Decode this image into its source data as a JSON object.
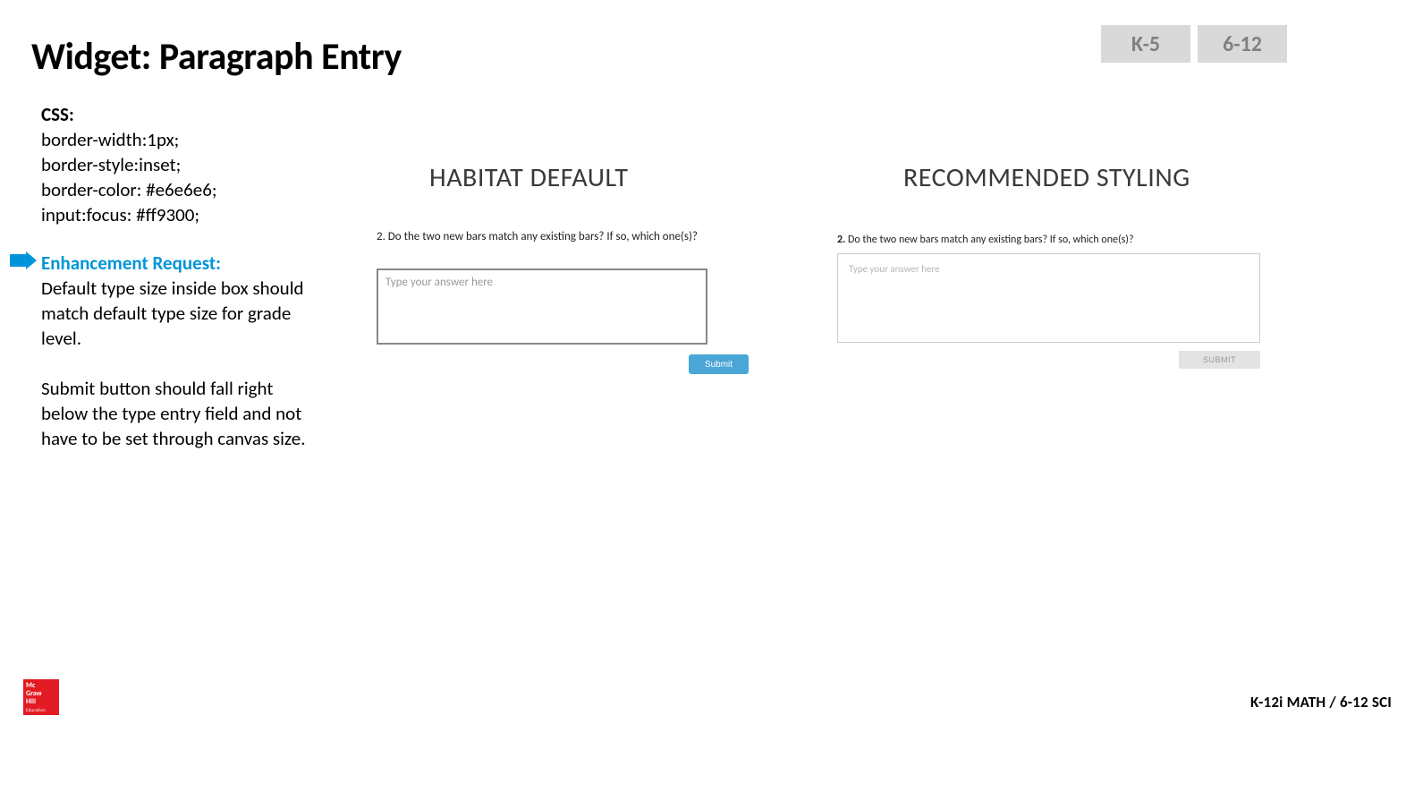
{
  "title": "Widget: Paragraph Entry",
  "tabs": {
    "k5": "K-5",
    "g612": "6-12"
  },
  "css": {
    "label": "CSS:",
    "lines": [
      "border-width:1px;",
      "border-style:inset;",
      "border-color: #e6e6e6;",
      "input:focus: #ff9300;"
    ]
  },
  "enhancement": {
    "title": "Enhancement Request:",
    "p1": "Default type size inside box should match default type size for grade level.",
    "p2": "Submit button should fall right below the type entry field and not have to be set through canvas size."
  },
  "columns": {
    "left_heading": "HABITAT DEFAULT",
    "right_heading": "RECOMMENDED STYLING"
  },
  "default_example": {
    "question": "2. Do the two new bars match any existing bars? If so, which one(s)?",
    "placeholder": "Type your answer here",
    "submit": "Submit"
  },
  "reco_example": {
    "qnum": "2.",
    "question": " Do the two new bars match any existing bars? If so, which one(s)?",
    "placeholder": "Type your answer here",
    "submit": "SUBMIT"
  },
  "logo": {
    "l1": "Mc",
    "l2": "Graw",
    "l3": "Hill",
    "edu": "Education"
  },
  "footer": "K-12i MATH / 6-12 SCI"
}
